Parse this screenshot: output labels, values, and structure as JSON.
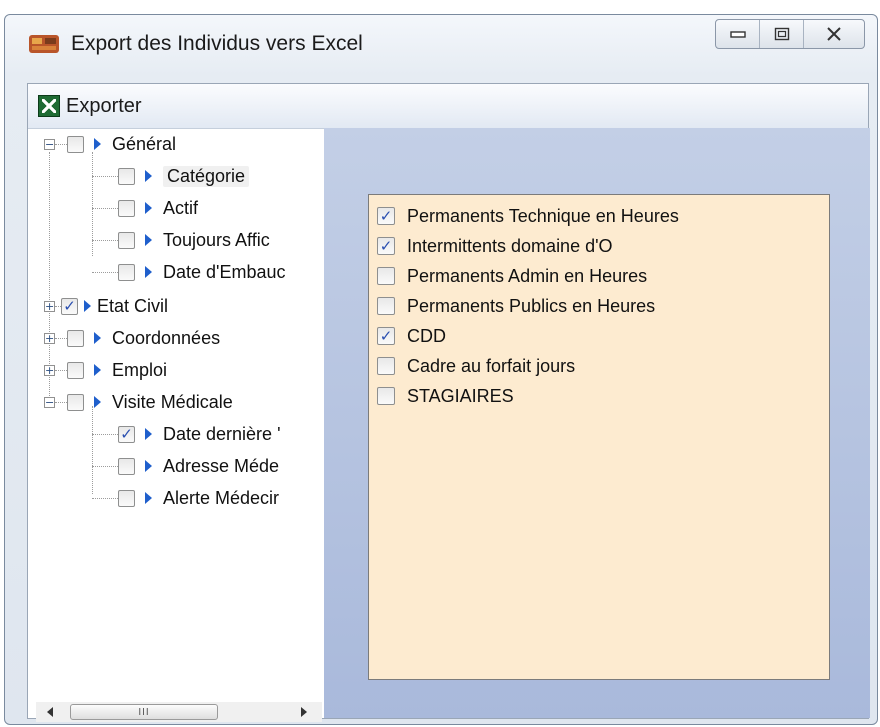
{
  "window": {
    "title": "Export des Individus vers Excel",
    "icon": "app-icon"
  },
  "toolbar": {
    "export_label": "Exporter",
    "export_icon": "excel-icon"
  },
  "tree": {
    "general": {
      "label": "Général",
      "expanded": true,
      "checked": false
    },
    "general_children": [
      {
        "label": "Catégorie",
        "checked": false,
        "selected": true
      },
      {
        "label": "Actif",
        "checked": false
      },
      {
        "label": "Toujours Affic",
        "checked": false
      },
      {
        "label": "Date d'Embauc",
        "checked": false
      }
    ],
    "etat_civil": {
      "label": "Etat Civil",
      "expanded": false,
      "checked": true
    },
    "coordonnees": {
      "label": "Coordonnées",
      "expanded": false,
      "checked": false
    },
    "emploi": {
      "label": "Emploi",
      "expanded": false,
      "checked": false
    },
    "visite": {
      "label": "Visite Médicale",
      "expanded": true,
      "checked": false
    },
    "visite_children": [
      {
        "label": "Date dernière '",
        "checked": true
      },
      {
        "label": "Adresse Méde",
        "checked": false
      },
      {
        "label": "Alerte Médecir",
        "checked": false
      }
    ]
  },
  "scrollbar": {
    "thumb_grip": "III"
  },
  "categories": [
    {
      "label": "Permanents Technique en Heures",
      "checked": true
    },
    {
      "label": "Intermittents domaine d'O",
      "checked": true
    },
    {
      "label": "Permanents Admin en Heures",
      "checked": false
    },
    {
      "label": "Permanents Publics en Heures",
      "checked": false
    },
    {
      "label": "CDD",
      "checked": true
    },
    {
      "label": "Cadre au forfait jours",
      "checked": false
    },
    {
      "label": "STAGIAIRES",
      "checked": false
    }
  ],
  "colors": {
    "list_background": "#fdebd0",
    "pane_background": "#b4c3e0",
    "check_color": "#2a4fb0",
    "tree_arrow": "#1f5fcc"
  }
}
